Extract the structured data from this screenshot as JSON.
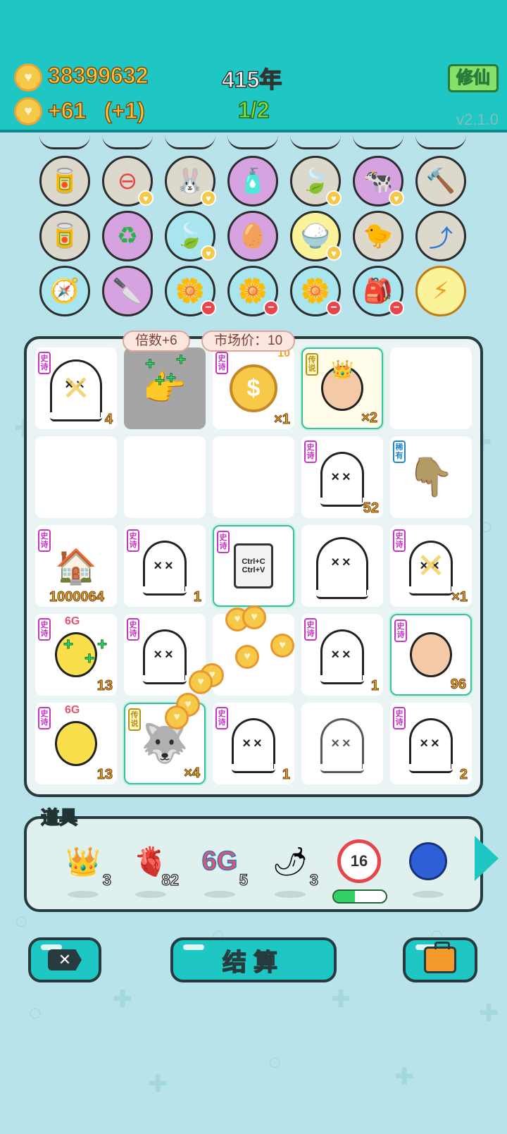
{
  "header": {
    "money": "38399632",
    "income": "+61",
    "income_bonus": "(+1)",
    "year": "415年",
    "progress": "1/2",
    "xiuxian_label": "修仙",
    "version": "v2.1.0"
  },
  "item_icons": {
    "row1": [
      "dog-food-icon",
      "no-entry-icon",
      "rabbit-icon",
      "bottle-icon",
      "leaf-icon",
      "cow-pair-icon",
      "hammer-icon"
    ],
    "row2": [
      "dog-food-icon",
      "recycle-icon",
      "leaf-icon",
      "eyepatch-egg-icon",
      "rice-bowl-icon",
      "chick-egg-icon",
      "arrow-card-icon"
    ],
    "row3": [
      "compass-icon",
      "cleaver-icon",
      "flower-pot-icon",
      "flower-pot-icon",
      "flower-pot-icon",
      "sack-icon",
      "lightning-icon"
    ]
  },
  "board": {
    "bubble_multiplier": "倍数+6",
    "bubble_market": "市场价：10",
    "tags": {
      "epic": "史诗",
      "legend": "传说",
      "rare": "稀有"
    },
    "badge_6g": "6G",
    "copy_text": "Ctrl+C\nCtrl+V",
    "coin_top_text": "10",
    "counts": {
      "r0c0": "4",
      "r0c2": "×1",
      "r0c3": "×2",
      "r1c3": "52",
      "r2c0": "1000064",
      "r2c1": "1",
      "r2c4": "×1",
      "r3c0": "13",
      "r3c3": "1",
      "r3c4": "96",
      "r4c0": "13",
      "r4c1": "×4",
      "r4c2": "1",
      "r4c4": "2"
    }
  },
  "tools": {
    "title": "道具",
    "items": [
      {
        "icon": "crown-icon",
        "count": "3"
      },
      {
        "icon": "liver-icon",
        "count": "82"
      },
      {
        "icon": "6g-icon",
        "label": "6G",
        "count": "5"
      },
      {
        "icon": "chili-icon",
        "count": "3"
      },
      {
        "icon": "timer-icon",
        "label": "16"
      },
      {
        "icon": "blueberry-icon"
      }
    ],
    "timer_progress": 0.4
  },
  "buttons": {
    "settle": "结算"
  }
}
